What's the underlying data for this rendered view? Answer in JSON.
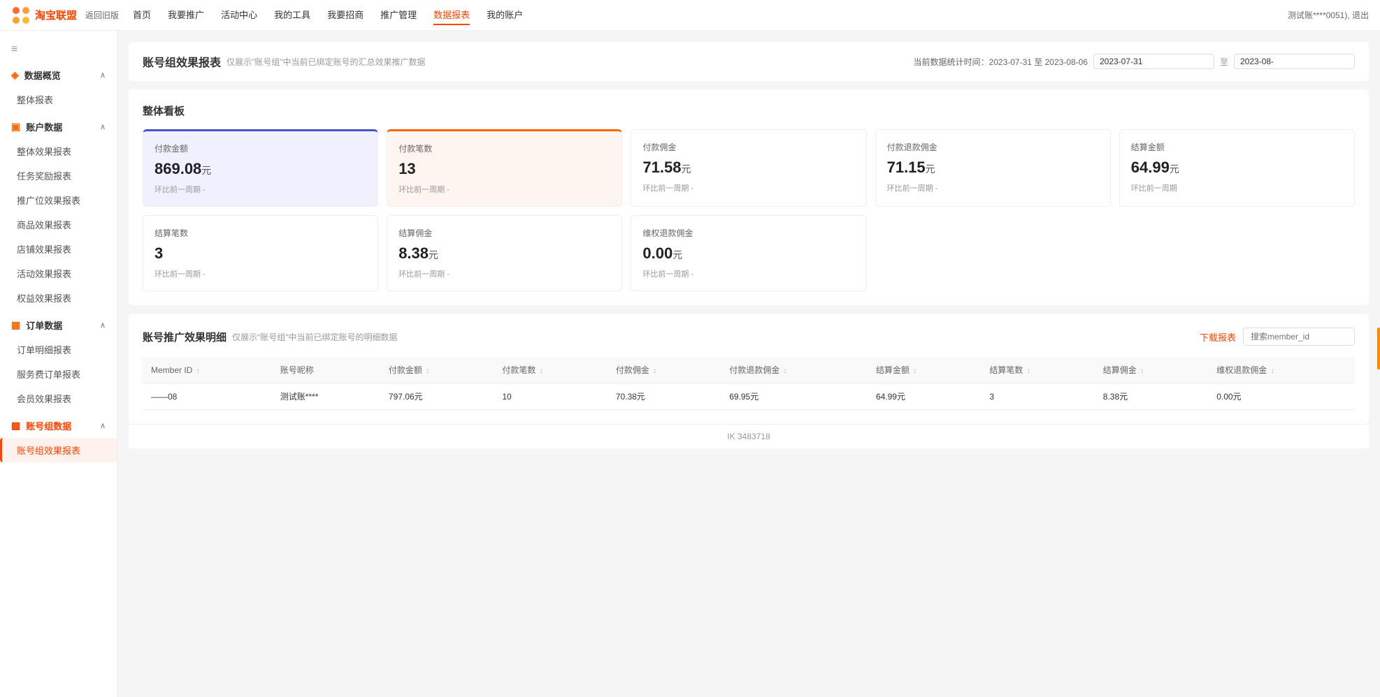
{
  "nav": {
    "logo_text": "淘宝联盟",
    "back_label": "返回旧版",
    "items": [
      {
        "label": "首页",
        "active": false
      },
      {
        "label": "我要推广",
        "active": false
      },
      {
        "label": "活动中心",
        "active": false
      },
      {
        "label": "我的工具",
        "active": false
      },
      {
        "label": "我要招商",
        "active": false
      },
      {
        "label": "推广管理",
        "active": false
      },
      {
        "label": "数据报表",
        "active": true
      },
      {
        "label": "我的账户",
        "active": false
      }
    ],
    "user_text": "测试账****0051), 退出"
  },
  "sidebar": {
    "hamburger": "≡",
    "sections": [
      {
        "icon": "◈",
        "label": "数据概览",
        "expanded": true,
        "items": [
          {
            "label": "整体报表",
            "active": false
          }
        ]
      },
      {
        "icon": "▣",
        "label": "账户数据",
        "expanded": true,
        "items": [
          {
            "label": "整体效果报表",
            "active": false
          },
          {
            "label": "任务奖励报表",
            "active": false
          },
          {
            "label": "推广位效果报表",
            "active": false
          },
          {
            "label": "商品效果报表",
            "active": false
          },
          {
            "label": "店铺效果报表",
            "active": false
          },
          {
            "label": "活动效果报表",
            "active": false
          },
          {
            "label": "权益效果报表",
            "active": false
          }
        ]
      },
      {
        "icon": "▦",
        "label": "订单数据",
        "expanded": true,
        "items": [
          {
            "label": "订单明细报表",
            "active": false
          },
          {
            "label": "服务费订单报表",
            "active": false
          },
          {
            "label": "会员效果报表",
            "active": false
          }
        ]
      },
      {
        "icon": "▩",
        "label": "账号组数据",
        "expanded": true,
        "orange": true,
        "items": [
          {
            "label": "账号组效果报表",
            "active": true
          }
        ]
      }
    ]
  },
  "page_header": {
    "title": "账号组效果报表",
    "subtitle": "仅展示\"账号组\"中当前已绑定账号的汇总效果推广数据",
    "time_prefix": "当前数据统计时间：2023-07-31 至 2023-08-06",
    "date_start": "2023-07-31",
    "date_end": "2023-08-",
    "date_separator": "至"
  },
  "dashboard": {
    "title": "整体看板",
    "stats_top": [
      {
        "label": "付款金额",
        "value": "869.08",
        "unit": "元",
        "compare": "环比前一周期 -",
        "style": "highlighted-blue"
      },
      {
        "label": "付款笔数",
        "value": "13",
        "unit": "",
        "compare": "环比前一周期 -",
        "style": "highlighted-orange"
      },
      {
        "label": "付款佣金",
        "value": "71.58",
        "unit": "元",
        "compare": "环比前一周期 -",
        "style": "normal"
      },
      {
        "label": "付款退款佣金",
        "value": "71.15",
        "unit": "元",
        "compare": "环比前一周期 -",
        "style": "normal"
      },
      {
        "label": "结算金额",
        "value": "64.99",
        "unit": "元",
        "compare": "环比前一周期",
        "style": "normal"
      }
    ],
    "stats_bottom": [
      {
        "label": "结算笔数",
        "value": "3",
        "unit": "",
        "compare": "环比前一周期 -",
        "style": "normal"
      },
      {
        "label": "结算佣金",
        "value": "8.38",
        "unit": "元",
        "compare": "环比前一周期 -",
        "style": "normal"
      },
      {
        "label": "维权退款佣金",
        "value": "0.00",
        "unit": "元",
        "compare": "环比前一周期 -",
        "style": "normal"
      }
    ]
  },
  "detail": {
    "title": "账号推广效果明细",
    "subtitle": "仅展示\"账号组\"中当前已绑定账号的明细数据",
    "download_label": "下载报表",
    "search_placeholder": "搜索member_id",
    "table_headers": [
      {
        "label": "Member ID",
        "sortable": true
      },
      {
        "label": "账号昵称",
        "sortable": false
      },
      {
        "label": "付款金额",
        "sortable": true
      },
      {
        "label": "付款笔数",
        "sortable": true
      },
      {
        "label": "付款佣金",
        "sortable": true
      },
      {
        "label": "付款退款佣金",
        "sortable": true
      },
      {
        "label": "结算金额",
        "sortable": true
      },
      {
        "label": "结算笔数",
        "sortable": true
      },
      {
        "label": "结算佣金",
        "sortable": true
      },
      {
        "label": "维权退款佣金",
        "sortable": true
      }
    ],
    "table_rows": [
      {
        "member_id": "——08",
        "nickname": "测试账****",
        "pay_amount": "797.06元",
        "pay_count": "10",
        "pay_commission": "70.38元",
        "pay_refund_commission": "69.95元",
        "settle_amount": "64.99元",
        "settle_count": "3",
        "settle_commission": "8.38元",
        "rights_refund": "0.00元"
      }
    ]
  },
  "footer": {
    "icp": "IK 3483718"
  }
}
